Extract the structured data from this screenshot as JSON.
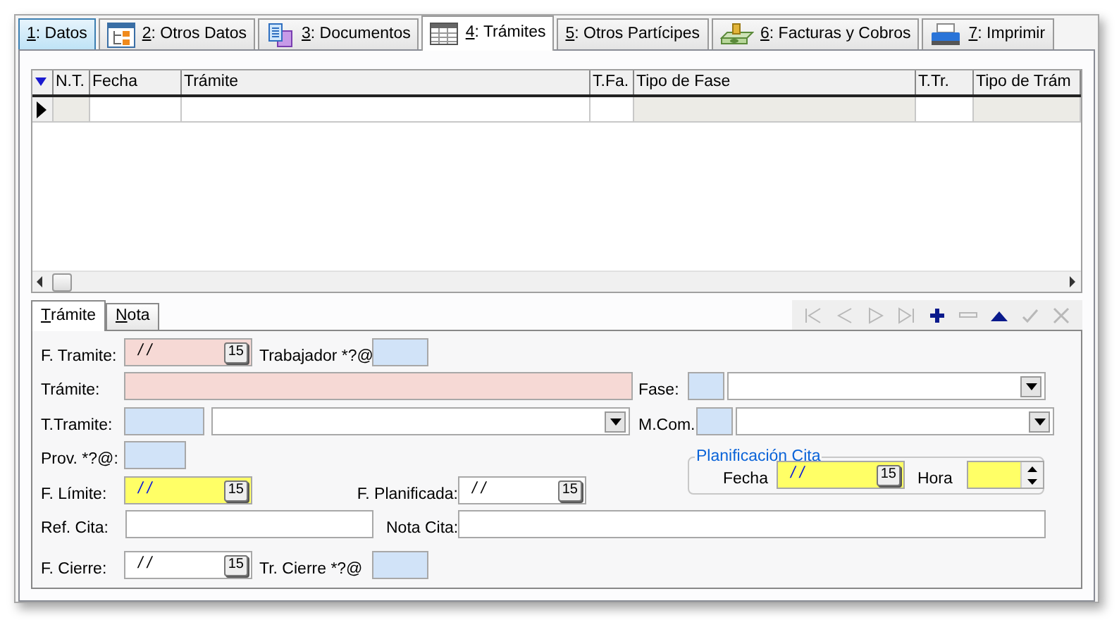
{
  "tabs": [
    {
      "label": "1: Datos",
      "selected": false,
      "hovered": true
    },
    {
      "label": "2: Otros Datos",
      "selected": false,
      "hovered": false
    },
    {
      "label": "3: Documentos",
      "selected": false,
      "hovered": false
    },
    {
      "label": "4: Trámites",
      "selected": true,
      "hovered": false
    },
    {
      "label": "5: Otros Partícipes",
      "selected": false,
      "hovered": false
    },
    {
      "label": "6: Facturas y Cobros",
      "selected": false,
      "hovered": false
    },
    {
      "label": "7: Imprimir",
      "selected": false,
      "hovered": false
    }
  ],
  "grid": {
    "columns": [
      {
        "title": "N.T.",
        "readonly": true
      },
      {
        "title": "Fecha",
        "readonly": false
      },
      {
        "title": "Trámite",
        "readonly": false
      },
      {
        "title": "T.Fa.",
        "readonly": false
      },
      {
        "title": "Tipo de Fase",
        "readonly": true
      },
      {
        "title": "T.Tr.",
        "readonly": false
      },
      {
        "title": "Tipo de Trám",
        "readonly": true
      }
    ],
    "rows": [
      {
        "selected": true
      }
    ]
  },
  "subtabs": [
    {
      "label": "Trámite",
      "selected": true
    },
    {
      "label": "Nota",
      "selected": false
    }
  ],
  "navigator": [
    {
      "kind": "first",
      "disabled": true
    },
    {
      "kind": "prior",
      "disabled": true
    },
    {
      "kind": "next",
      "disabled": true
    },
    {
      "kind": "last",
      "disabled": true
    },
    {
      "kind": "insert",
      "disabled": false
    },
    {
      "kind": "delete",
      "disabled": true
    },
    {
      "kind": "edit",
      "disabled": false
    },
    {
      "kind": "post",
      "disabled": true
    },
    {
      "kind": "cancel",
      "disabled": true
    }
  ],
  "form": {
    "f_tramite": {
      "label": "F. Tramite:",
      "value": "/ /",
      "button": "15",
      "required": true,
      "lookup": false,
      "focused": false
    },
    "trabajador": {
      "label": "Trabajador *?@",
      "required": false,
      "lookup": true,
      "focused": false
    },
    "tramite": {
      "label": "Trámite:",
      "required": true,
      "lookup": false,
      "focused": false
    },
    "fase": {
      "label": "Fase:",
      "required": false,
      "lookup": true,
      "focused": false
    },
    "t_tramite": {
      "label": "T.Tramite:",
      "required": false,
      "lookup": true,
      "focused": false
    },
    "m_com": {
      "label": "M.Com.",
      "required": false,
      "lookup": true,
      "focused": false
    },
    "prov": {
      "label": "Prov. *?@:",
      "required": false,
      "lookup": true,
      "focused": false
    },
    "f_limite": {
      "label": "F. Límite:",
      "value": "/ /",
      "button": "15",
      "required": false,
      "lookup": false,
      "focused": true
    },
    "f_planificada": {
      "label": "F. Planificada:",
      "value": "/ /",
      "button": "15",
      "required": false,
      "lookup": false,
      "focused": false
    },
    "planificacion": {
      "title": "Planificación Cita",
      "fecha": {
        "label": "Fecha",
        "value": "/ /",
        "button": "15",
        "required": false,
        "lookup": false,
        "focused": true
      },
      "hora": {
        "label": "Hora",
        "required": false,
        "lookup": false,
        "focused": true
      }
    },
    "ref_cita": {
      "label": "Ref. Cita:",
      "required": false,
      "lookup": false,
      "focused": false
    },
    "nota_cita": {
      "label": "Nota Cita:",
      "required": false,
      "lookup": false,
      "focused": false
    },
    "f_cierre": {
      "label": "F. Cierre:",
      "value": "/ /",
      "button": "15",
      "required": false,
      "lookup": false,
      "focused": false
    },
    "tr_cierre": {
      "label": "Tr. Cierre *?@",
      "required": false,
      "lookup": true,
      "focused": false
    }
  }
}
